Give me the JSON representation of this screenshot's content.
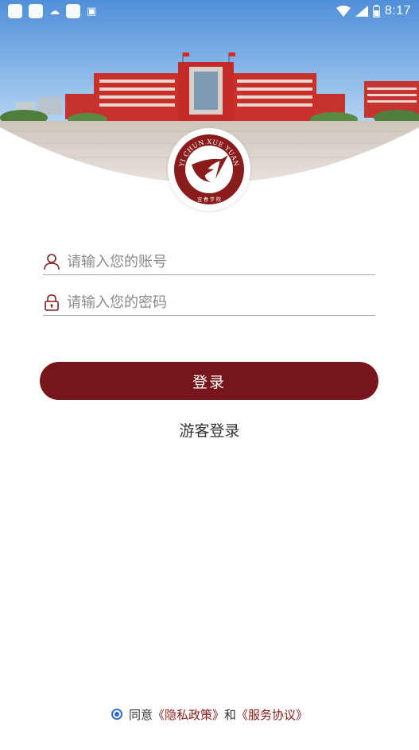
{
  "status_bar": {
    "time": "8:17",
    "icons": [
      "notification-square-icon",
      "notification-square-icon",
      "cloud-icon",
      "notification-square-icon",
      "font-icon",
      "wifi-icon",
      "signal-icon",
      "battery-icon"
    ]
  },
  "emblem": {
    "arc_text": "YI CHUN XUE YUAN",
    "bottom_text": "宜 春 学 院",
    "color": "#8a1c1c"
  },
  "form": {
    "account_placeholder": "请输入您的账号",
    "account_value": "",
    "password_placeholder": "请输入您的密码",
    "password_value": "",
    "login_label": "登录",
    "guest_label": "游客登录"
  },
  "agreement": {
    "prefix": "同意",
    "privacy_link": "《隐私政策》",
    "conjunction": "和",
    "service_link": "《服务协议》",
    "checked": true
  },
  "colors": {
    "primary": "#76161c",
    "link": "#8c1a1a",
    "radio": "#2f6fd1"
  }
}
